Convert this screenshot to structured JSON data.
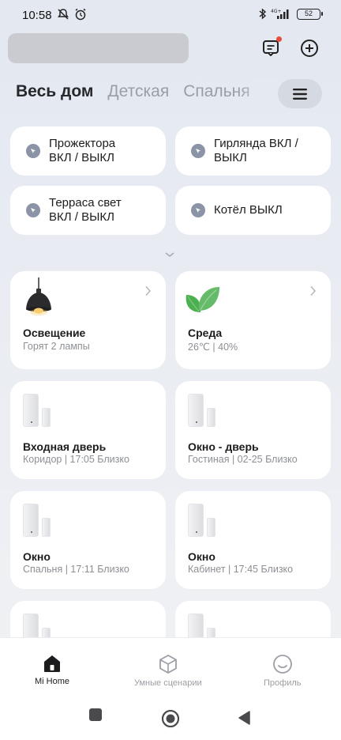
{
  "status_bar": {
    "time": "10:58",
    "battery": "52",
    "network": "4G+"
  },
  "header": {
    "account_redacted": true
  },
  "rooms": {
    "tabs": [
      {
        "label": "Весь дом",
        "active": true
      },
      {
        "label": "Детская",
        "active": false
      },
      {
        "label": "Спальня",
        "active": false
      }
    ]
  },
  "scenes": [
    {
      "line1": "Прожектора",
      "line2": "ВКЛ / ВЫКЛ"
    },
    {
      "line1": "Гирлянда ВКЛ /",
      "line2": "ВЫКЛ"
    },
    {
      "line1": "Терраса свет",
      "line2": "ВКЛ / ВЫКЛ"
    },
    {
      "line1": "Котёл ВЫКЛ",
      "line2": ""
    }
  ],
  "cards": {
    "lighting": {
      "title": "Освещение",
      "subtitle": "Горят 2 лампы",
      "icon": "pendant-lamp-icon"
    },
    "environment": {
      "title": "Среда",
      "subtitle": "26℃ | 40%",
      "icon": "leaf-icon"
    },
    "devices": [
      {
        "title": "Входная дверь",
        "subtitle": "Коридор | 17:05 Близко"
      },
      {
        "title": "Окно - дверь",
        "subtitle": "Гостиная | 02-25 Близко"
      },
      {
        "title": "Окно",
        "subtitle": "Спальня | 17:11 Близко"
      },
      {
        "title": "Окно",
        "subtitle": "Кабинет | 17:45 Близко"
      }
    ]
  },
  "bottom_nav": {
    "items": [
      {
        "label": "Mi Home",
        "icon": "home-icon",
        "active": true
      },
      {
        "label": "Умные сценарии",
        "icon": "cube-icon",
        "active": false
      },
      {
        "label": "Профиль",
        "icon": "smile-icon",
        "active": false
      }
    ]
  },
  "colors": {
    "accent_dot": "#e94b3c",
    "scene_icon": "#8b93a6",
    "background": "#e6eaf1"
  }
}
